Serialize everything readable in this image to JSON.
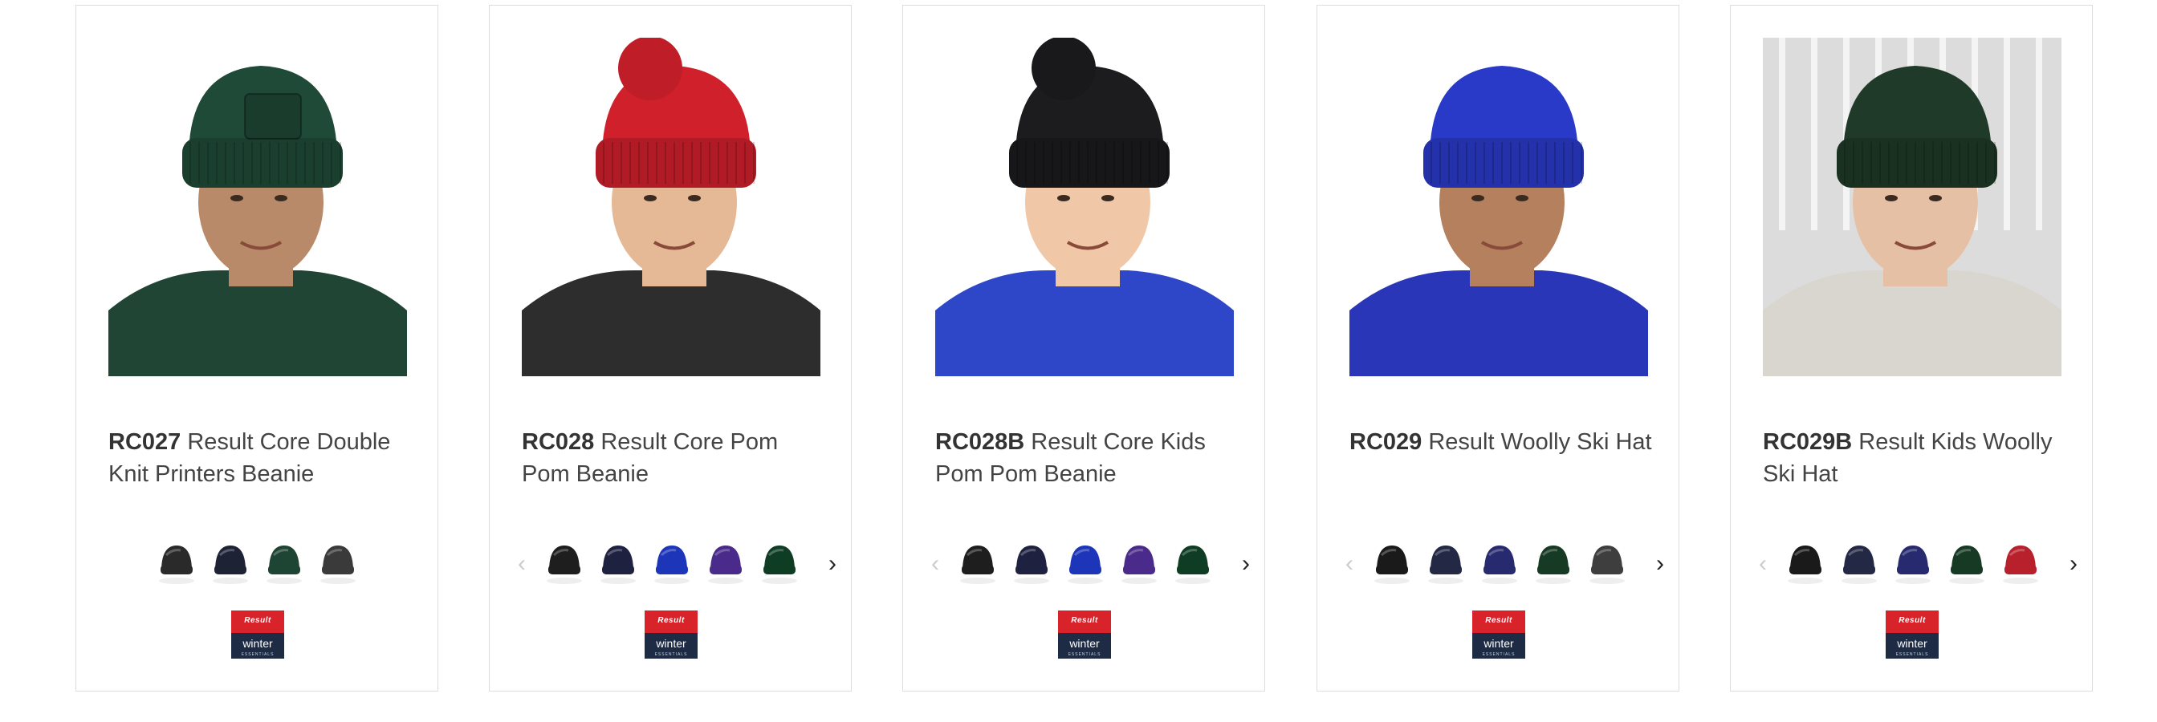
{
  "products": [
    {
      "code": "RC027",
      "name": "Result Core Double Knit Printers Beanie",
      "image_alt": "Man wearing green beanie with patch",
      "hat_color": "#1f4a38",
      "skin": "#b98a6a",
      "clothing": "#204535",
      "has_pom": false,
      "has_patch": true,
      "photo_bg": "#ffffff",
      "swatches": [
        "#2a2a2a",
        "#1e2235",
        "#1e4434",
        "#3a3a3a"
      ],
      "swatch_carousel": false,
      "brand": {
        "top": "Result",
        "bottom": "winter",
        "sub": "ESSENTIALS"
      }
    },
    {
      "code": "RC028",
      "name": "Result Core Pom Pom Beanie",
      "image_alt": "Woman wearing red pom pom beanie",
      "hat_color": "#d0202c",
      "skin": "#e5b896",
      "clothing": "#2d2d2d",
      "has_pom": true,
      "has_patch": false,
      "photo_bg": "#ffffff",
      "swatches": [
        "#1e1e1e",
        "#1e2240",
        "#1d35b8",
        "#4a2a8a",
        "#0f3d24"
      ],
      "swatch_carousel": true,
      "brand": {
        "top": "Result",
        "bottom": "winter",
        "sub": "ESSENTIALS"
      }
    },
    {
      "code": "RC028B",
      "name": "Result Core Kids Pom Pom Beanie",
      "image_alt": "Boy wearing black pom pom beanie",
      "hat_color": "#1c1c1e",
      "skin": "#f0c8a8",
      "clothing": "#2e46c8",
      "has_pom": true,
      "has_patch": false,
      "photo_bg": "#ffffff",
      "swatches": [
        "#1e1e1e",
        "#1e2240",
        "#1d35b8",
        "#4a2a8a",
        "#0f3d24"
      ],
      "swatch_carousel": true,
      "brand": {
        "top": "Result",
        "bottom": "winter",
        "sub": "ESSENTIALS"
      }
    },
    {
      "code": "RC029",
      "name": "Result Woolly Ski Hat",
      "image_alt": "Man wearing royal blue woolly hat",
      "hat_color": "#2a3ac8",
      "skin": "#b5805e",
      "clothing": "#2a36b8",
      "has_pom": false,
      "has_patch": false,
      "photo_bg": "#ffffff",
      "swatches": [
        "#1a1a1a",
        "#232845",
        "#272a6e",
        "#173a24",
        "#3e3e3e"
      ],
      "swatch_carousel": true,
      "brand": {
        "top": "Result",
        "bottom": "winter",
        "sub": "ESSENTIALS"
      }
    },
    {
      "code": "RC029B",
      "name": "Result Kids Woolly Ski Hat",
      "image_alt": "Boy wearing dark green woolly hat",
      "hat_color": "#1f3a28",
      "skin": "#e6c0a5",
      "clothing": "#d8d6cf",
      "has_pom": false,
      "has_patch": false,
      "photo_bg": "#dcdcdc",
      "swatches": [
        "#1a1a1a",
        "#232845",
        "#272a6e",
        "#173a24",
        "#b8202c"
      ],
      "swatch_carousel": true,
      "brand": {
        "top": "Result",
        "bottom": "winter",
        "sub": "ESSENTIALS"
      }
    }
  ],
  "carousel": {
    "prev_icon": "‹",
    "next_icon": "›"
  }
}
